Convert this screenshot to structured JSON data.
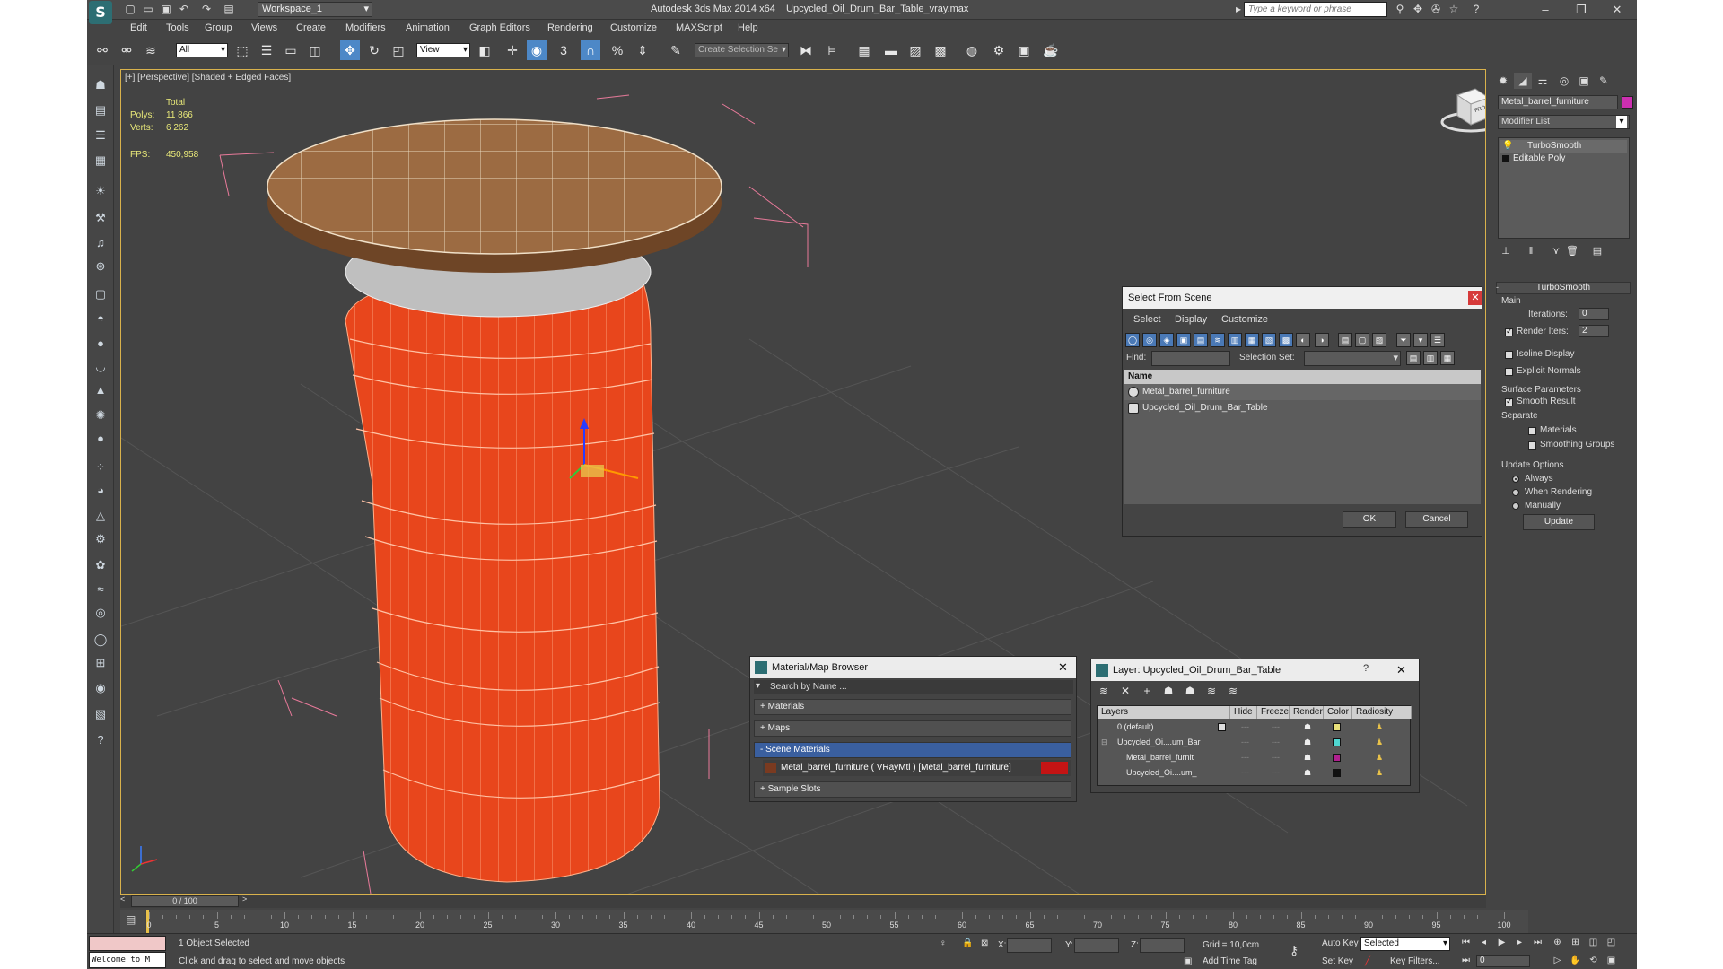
{
  "titlebar": {
    "workspace": "Workspace_1",
    "app_title": "Autodesk 3ds Max  2014 x64",
    "file_name": "Upcycled_Oil_Drum_Bar_Table_vray.max",
    "search_placeholder": "Type a keyword or phrase"
  },
  "menu": [
    "Edit",
    "Tools",
    "Group",
    "Views",
    "Create",
    "Modifiers",
    "Animation",
    "Graph Editors",
    "Rendering",
    "Customize",
    "MAXScript",
    "Help"
  ],
  "toolbar": {
    "filter": "All",
    "ref_coord": "View",
    "selection_set_placeholder": "Create Selection Se"
  },
  "viewport": {
    "label": "[+] [Perspective] [Shaded + Edged Faces]",
    "stats": {
      "total_label": "Total",
      "polys_label": "Polys:",
      "polys": "11 866",
      "verts_label": "Verts:",
      "verts": "6 262",
      "fps_label": "FPS:",
      "fps": "450,958"
    },
    "viewcube_label": "FRONT"
  },
  "command_panel": {
    "object_name": "Metal_barrel_furniture",
    "modifier_list": "Modifier List",
    "stack": [
      "TurboSmooth",
      "Editable Poly"
    ],
    "turbosmooth": {
      "title": "TurboSmooth",
      "main_label": "Main",
      "iterations_label": "Iterations:",
      "iterations": "0",
      "render_iters_label": "Render Iters:",
      "render_iters": "2",
      "isoline": "Isoline Display",
      "explicit_normals": "Explicit Normals",
      "surface_params": "Surface Parameters",
      "smooth_result": "Smooth Result",
      "separate": "Separate",
      "materials": "Materials",
      "smoothing_groups": "Smoothing Groups",
      "update_options": "Update Options",
      "always": "Always",
      "when_rendering": "When Rendering",
      "manually": "Manually",
      "update_button": "Update"
    }
  },
  "select_from_scene": {
    "title": "Select From Scene",
    "menu": [
      "Select",
      "Display",
      "Customize"
    ],
    "find_label": "Find:",
    "selection_set_label": "Selection Set:",
    "column_name": "Name",
    "items": [
      "Metal_barrel_furniture",
      "Upcycled_Oil_Drum_Bar_Table"
    ],
    "ok": "OK",
    "cancel": "Cancel"
  },
  "material_browser": {
    "title": "Material/Map Browser",
    "search_placeholder": "Search by Name ...",
    "sections": [
      "+ Materials",
      "+ Maps",
      "- Scene Materials"
    ],
    "scene_material": "Metal_barrel_furniture  ( VRayMtl )  [Metal_barrel_furniture]",
    "sample_slots": "+ Sample Slots"
  },
  "layer_dialog": {
    "title": "Layer: Upcycled_Oil_Drum_Bar_Table",
    "columns": [
      "Layers",
      "Hide",
      "Freeze",
      "Render",
      "Color",
      "Radiosity"
    ],
    "rows": [
      {
        "name": "0 (default)",
        "color": "#e8e07a"
      },
      {
        "name": "Upcycled_Oi....um_Bar",
        "color": "#4fd6d0"
      },
      {
        "name": "Metal_barrel_furnit",
        "color": "#b01f8f"
      },
      {
        "name": "Upcycled_Oi....um_",
        "color": "#111111"
      }
    ]
  },
  "timeline": {
    "frame_counter": "0 / 100",
    "ticks": [
      "0",
      "5",
      "10",
      "15",
      "20",
      "25",
      "30",
      "35",
      "40",
      "45",
      "50",
      "55",
      "60",
      "65",
      "70",
      "75",
      "80",
      "85",
      "90",
      "95",
      "100"
    ]
  },
  "status": {
    "maxscript": "Welcome to M",
    "selected": "1 Object Selected",
    "prompt": "Click and drag to select and move objects",
    "x_label": "X:",
    "y_label": "Y:",
    "z_label": "Z:",
    "grid": "Grid = 10,0cm",
    "add_time_tag": "Add Time Tag",
    "auto_key": "Auto Key",
    "set_key": "Set Key",
    "selected_dd": "Selected",
    "key_filters": "Key Filters...",
    "frame_field": "0"
  }
}
